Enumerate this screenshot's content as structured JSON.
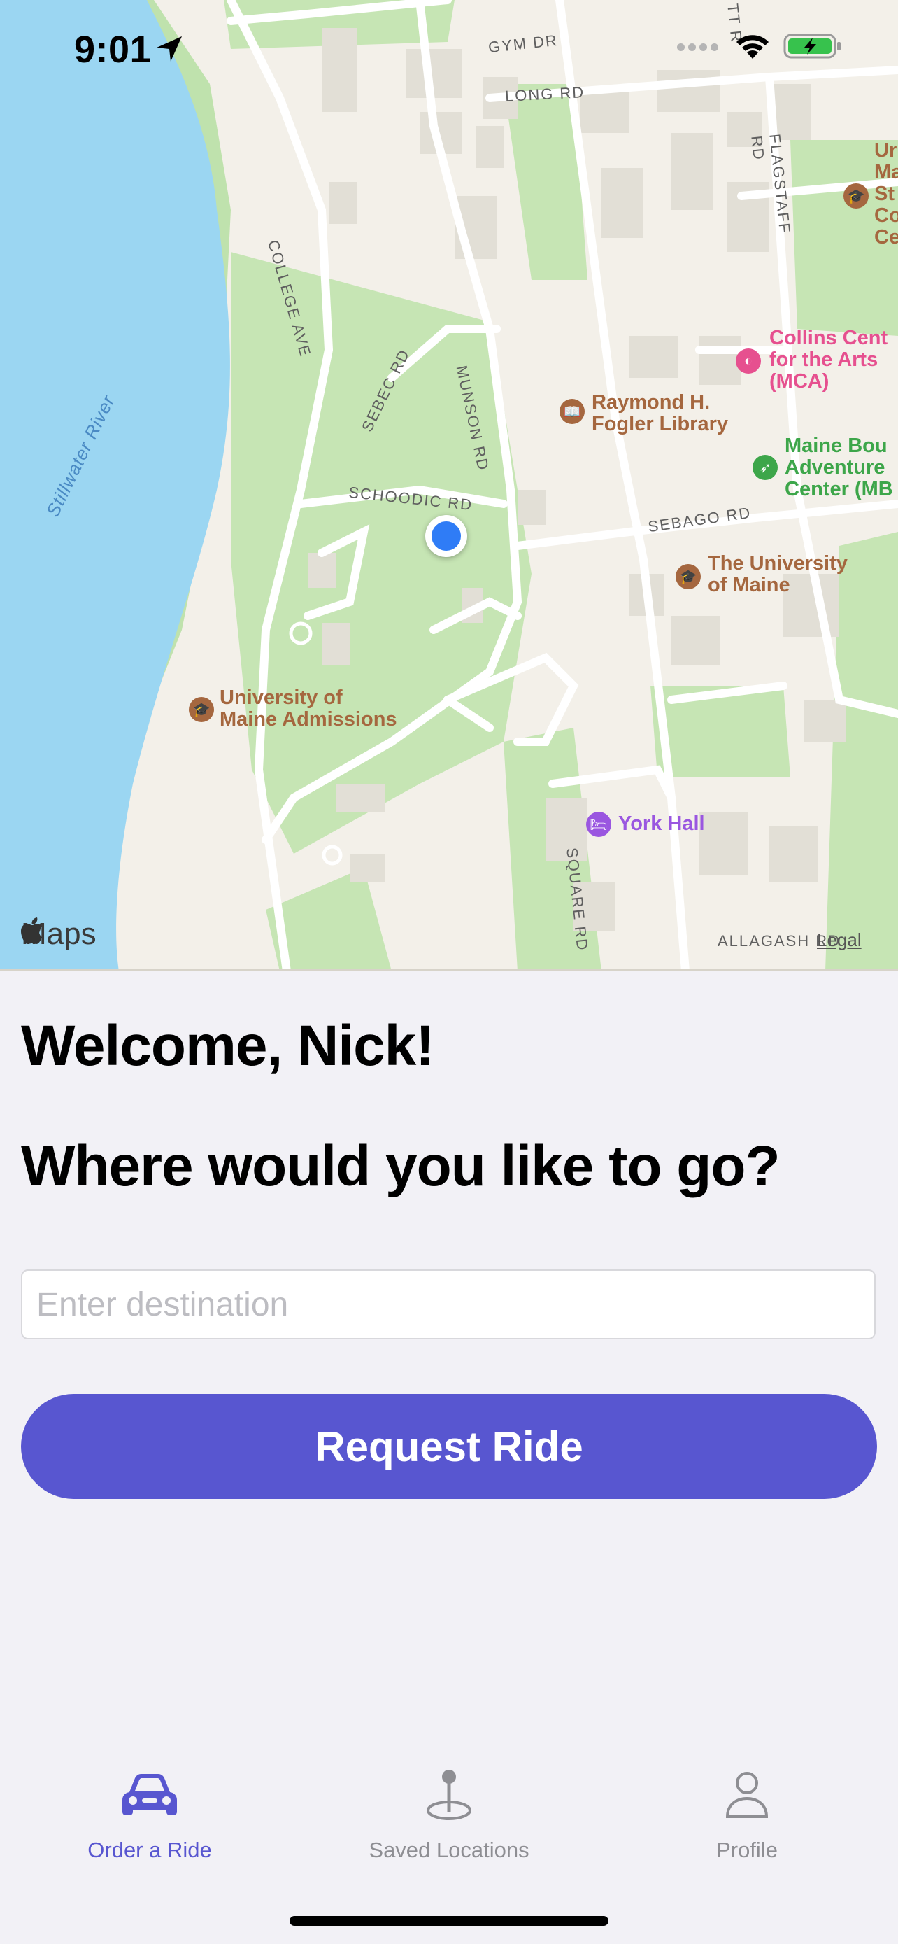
{
  "status_bar": {
    "time": "9:01"
  },
  "map": {
    "attribution": "Maps",
    "legal": "Legal",
    "river": "Stillwater River",
    "roads": [
      "GYM DR",
      "LONG RD",
      "COLLEGE AVE",
      "SEBEC RD",
      "MUNSON RD",
      "SCHOODIC RD",
      "SEBAGO RD",
      "FLAGSTAFF RD",
      "SQUARE RD",
      "ALLAGASH RD",
      "TT R"
    ],
    "pois": {
      "raymond": "Raymond H.\nFogler Library",
      "collins": "Collins Cent\nfor the Arts\n(MCA)",
      "maine_bound": "Maine Bou\nAdventure\nCenter (MB",
      "umaine": "The University\nof Maine",
      "admissions": "University of\nMaine Admissions",
      "york": "York Hall",
      "edge_top_right": "Ur\nMa\nSt\nCo\nCe"
    }
  },
  "main": {
    "welcome": "Welcome, Nick!",
    "question": "Where would you like to go?",
    "destination_placeholder": "Enter destination",
    "destination_value": "",
    "request_button": "Request Ride"
  },
  "tabbar": {
    "tabs": [
      {
        "label": "Order a Ride",
        "icon": "car-icon",
        "active": true
      },
      {
        "label": "Saved Locations",
        "icon": "map-pin-icon",
        "active": false
      },
      {
        "label": "Profile",
        "icon": "person-icon",
        "active": false
      }
    ]
  },
  "colors": {
    "accent": "#5856d0",
    "inactive": "#8e8e93",
    "background": "#f2f1f6"
  }
}
